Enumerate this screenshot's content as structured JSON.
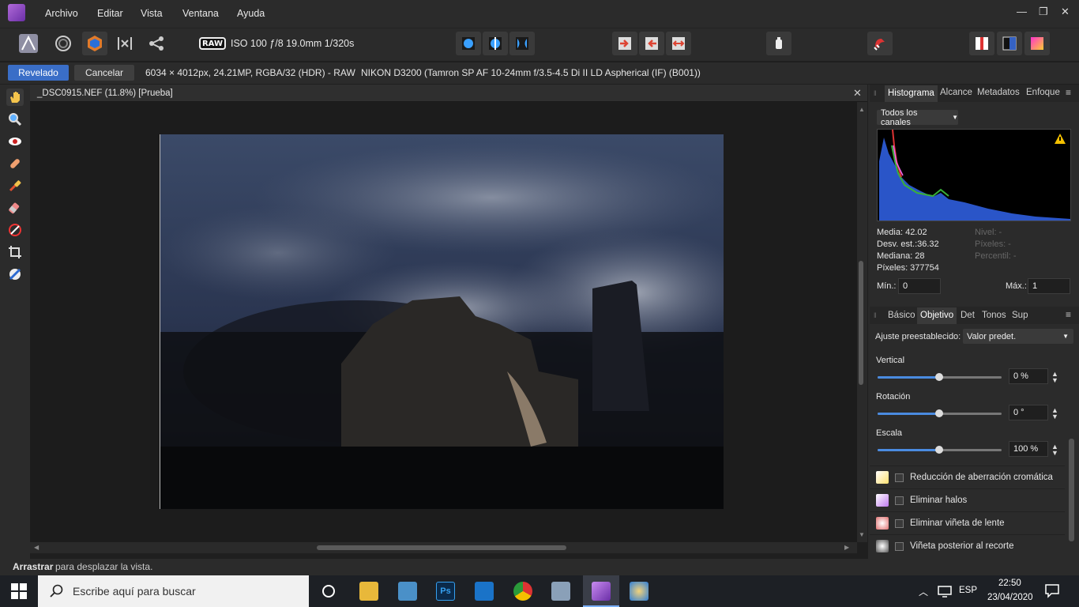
{
  "menu": [
    "Archivo",
    "Editar",
    "Vista",
    "Ventana",
    "Ayuda"
  ],
  "toolbar": {
    "raw_badge": "RAW",
    "raw_info": "ISO 100 ƒ/8 19.0mm 1/320s"
  },
  "context": {
    "primary_label": "Revelado",
    "secondary_label": "Cancelar",
    "image_info": "6034 × 4012px, 24.21MP, RGBA/32 (HDR) - RAW",
    "camera_info": "NIKON D3200 (Tamron SP AF 10-24mm f/3.5-4.5 Di II LD Aspherical (IF) (B001))"
  },
  "document": {
    "title": "_DSC0915.NEF (11.8%) [Prueba]",
    "close": "✕"
  },
  "histogram_panel": {
    "tabs": [
      "Histograma",
      "Alcance",
      "Metadatos",
      "Enfoque"
    ],
    "channel": "Todos los canales",
    "stats_left": [
      "Media: 42.02",
      "Desv. est.:36.32",
      "Mediana: 28",
      "Píxeles: 377754"
    ],
    "stats_right": [
      "Nivel: -",
      "Píxeles: -",
      "Percentil: -"
    ],
    "min_label": "Mín.:",
    "min_value": "0",
    "max_label": "Máx.:",
    "max_value": "1"
  },
  "develop_panel": {
    "tabs": [
      "Básico",
      "Objetivo",
      "Det",
      "Tonos",
      "Sup"
    ],
    "preset_label": "Ajuste preestablecido:",
    "preset_value": "Valor predet.",
    "sliders": [
      {
        "label": "Vertical",
        "value": "0 %",
        "level": 0.5
      },
      {
        "label": "Rotación",
        "value": "0 °",
        "level": 0.5
      },
      {
        "label": "Escala",
        "value": "100 %",
        "level": 0.5
      }
    ],
    "options": [
      "Reducción de aberración cromática",
      "Eliminar halos",
      "Eliminar viñeta de lente",
      "Viñeta posterior al recorte"
    ]
  },
  "status": {
    "bold": "Arrastrar",
    "rest": " para desplazar la vista."
  },
  "taskbar": {
    "search_placeholder": "Escribe aquí para buscar",
    "lang": "ESP",
    "time": "22:50",
    "date": "23/04/2020"
  },
  "colors": {
    "accent": "#3a6ec7",
    "panel": "#2b2b2b"
  }
}
